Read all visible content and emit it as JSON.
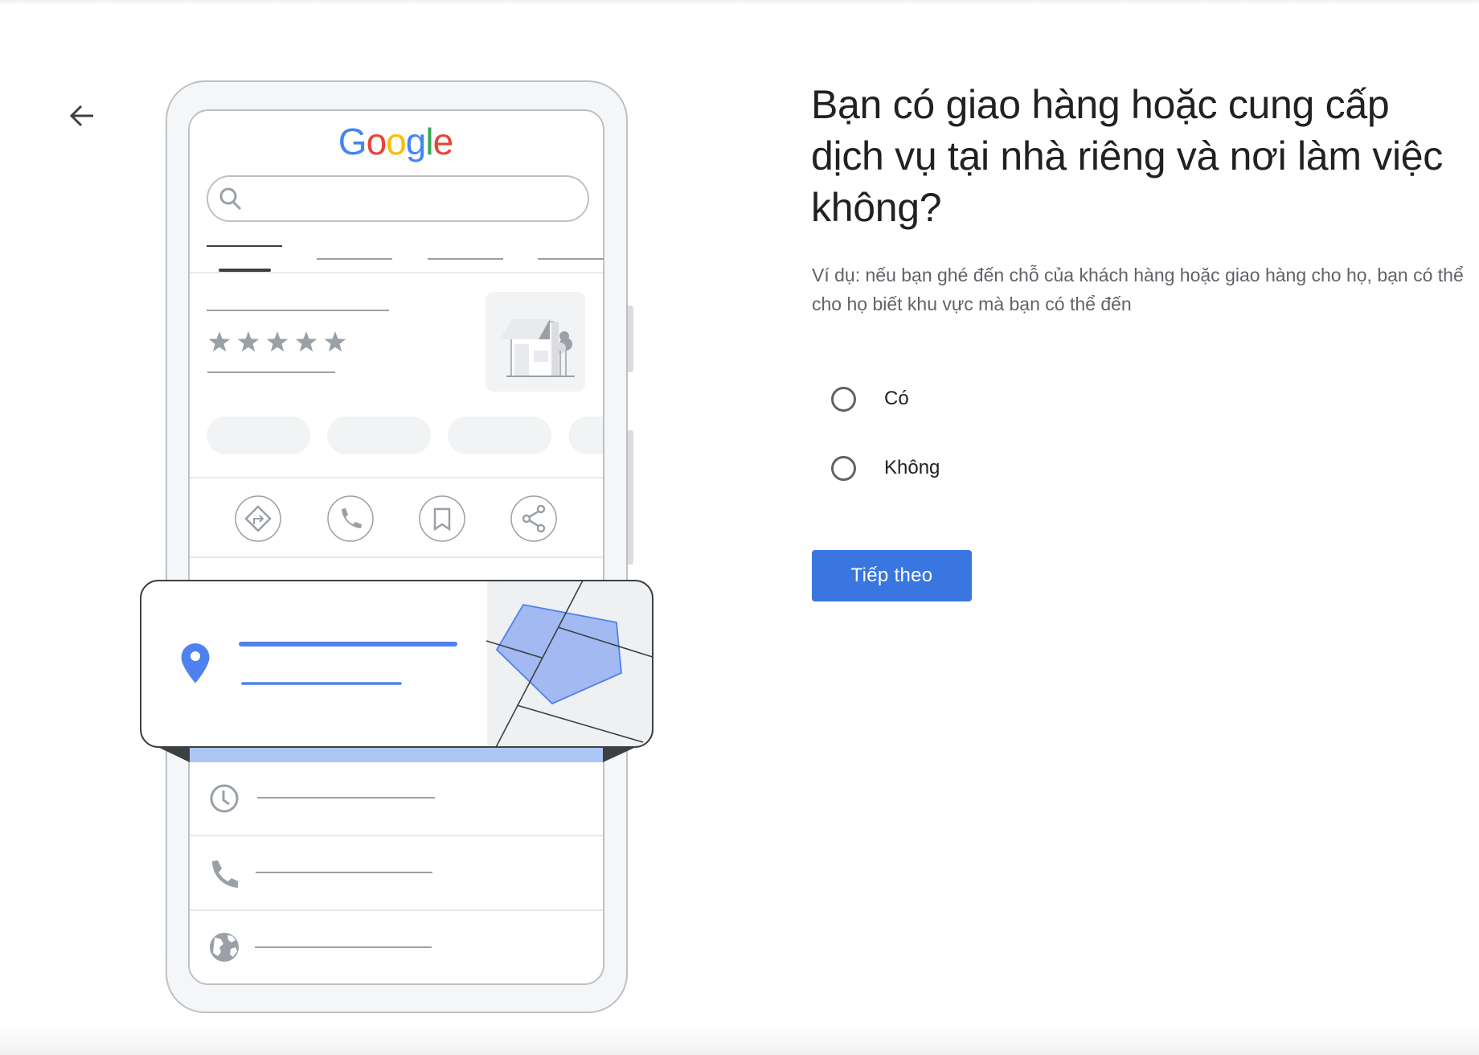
{
  "navigation": {
    "back_icon": "arrow-left-icon",
    "back_label": "Back"
  },
  "illustration": {
    "brand_logo": {
      "letters": [
        "G",
        "o",
        "o",
        "g",
        "l",
        "e"
      ],
      "colors": [
        "#4285f4",
        "#ea4335",
        "#fbbc05",
        "#4285f4",
        "#34a853",
        "#ea4335"
      ]
    },
    "search_icon": "search-icon",
    "rating_stars": 5,
    "action_icons": [
      "directions-icon",
      "phone-icon",
      "bookmark-icon",
      "share-icon"
    ],
    "info_rows": [
      "clock-icon",
      "phone-icon",
      "globe-icon"
    ],
    "location_card": {
      "pin_icon": "location-pin-icon",
      "accent": "#4f82ee",
      "area_fill": "#a2b9f1",
      "band_color": "#aec6f4"
    }
  },
  "question": {
    "title": "Bạn có giao hàng hoặc cung cấp dịch vụ tại nhà riêng và nơi làm việc không?",
    "hint": "Ví dụ: nếu bạn ghé đến chỗ của khách hàng hoặc giao hàng cho họ, bạn có thể cho họ biết khu vực mà bạn có thể đến"
  },
  "options": [
    {
      "label": "Có",
      "selected": false
    },
    {
      "label": "Không",
      "selected": false
    }
  ],
  "actions": {
    "next_label": "Tiếp theo",
    "accent": "#3a76e0"
  }
}
